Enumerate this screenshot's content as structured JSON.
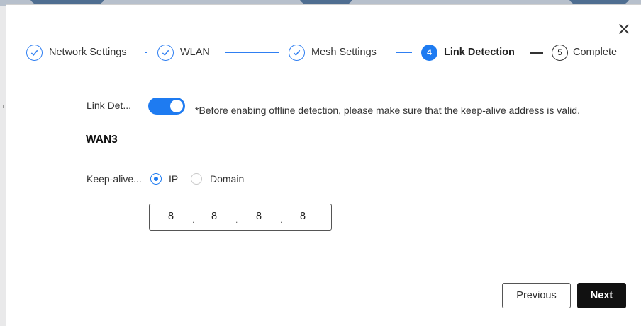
{
  "steps": [
    {
      "label": "Network Settings",
      "state": "done",
      "icon": "check-icon"
    },
    {
      "label": "WLAN",
      "state": "done",
      "icon": "check-icon"
    },
    {
      "label": "Mesh Settings",
      "state": "done",
      "icon": "check-icon"
    },
    {
      "number": "4",
      "label": "Link Detection",
      "state": "active"
    },
    {
      "number": "5",
      "label": "Complete",
      "state": "todo"
    }
  ],
  "form": {
    "link_detection_label": "Link Det...",
    "link_detection_enabled": true,
    "note": "*Before enabing offline detection, please make sure that the keep-alive address is valid.",
    "section_title": "WAN3",
    "keepalive_label": "Keep-alive...",
    "options": [
      {
        "label": "IP",
        "selected": true
      },
      {
        "label": "Domain",
        "selected": false
      }
    ],
    "ip": [
      "8",
      "8",
      "8",
      "8"
    ]
  },
  "buttons": {
    "previous": "Previous",
    "next": "Next"
  },
  "colors": {
    "accent": "#1e7bf1",
    "primary_button": "#111111"
  }
}
